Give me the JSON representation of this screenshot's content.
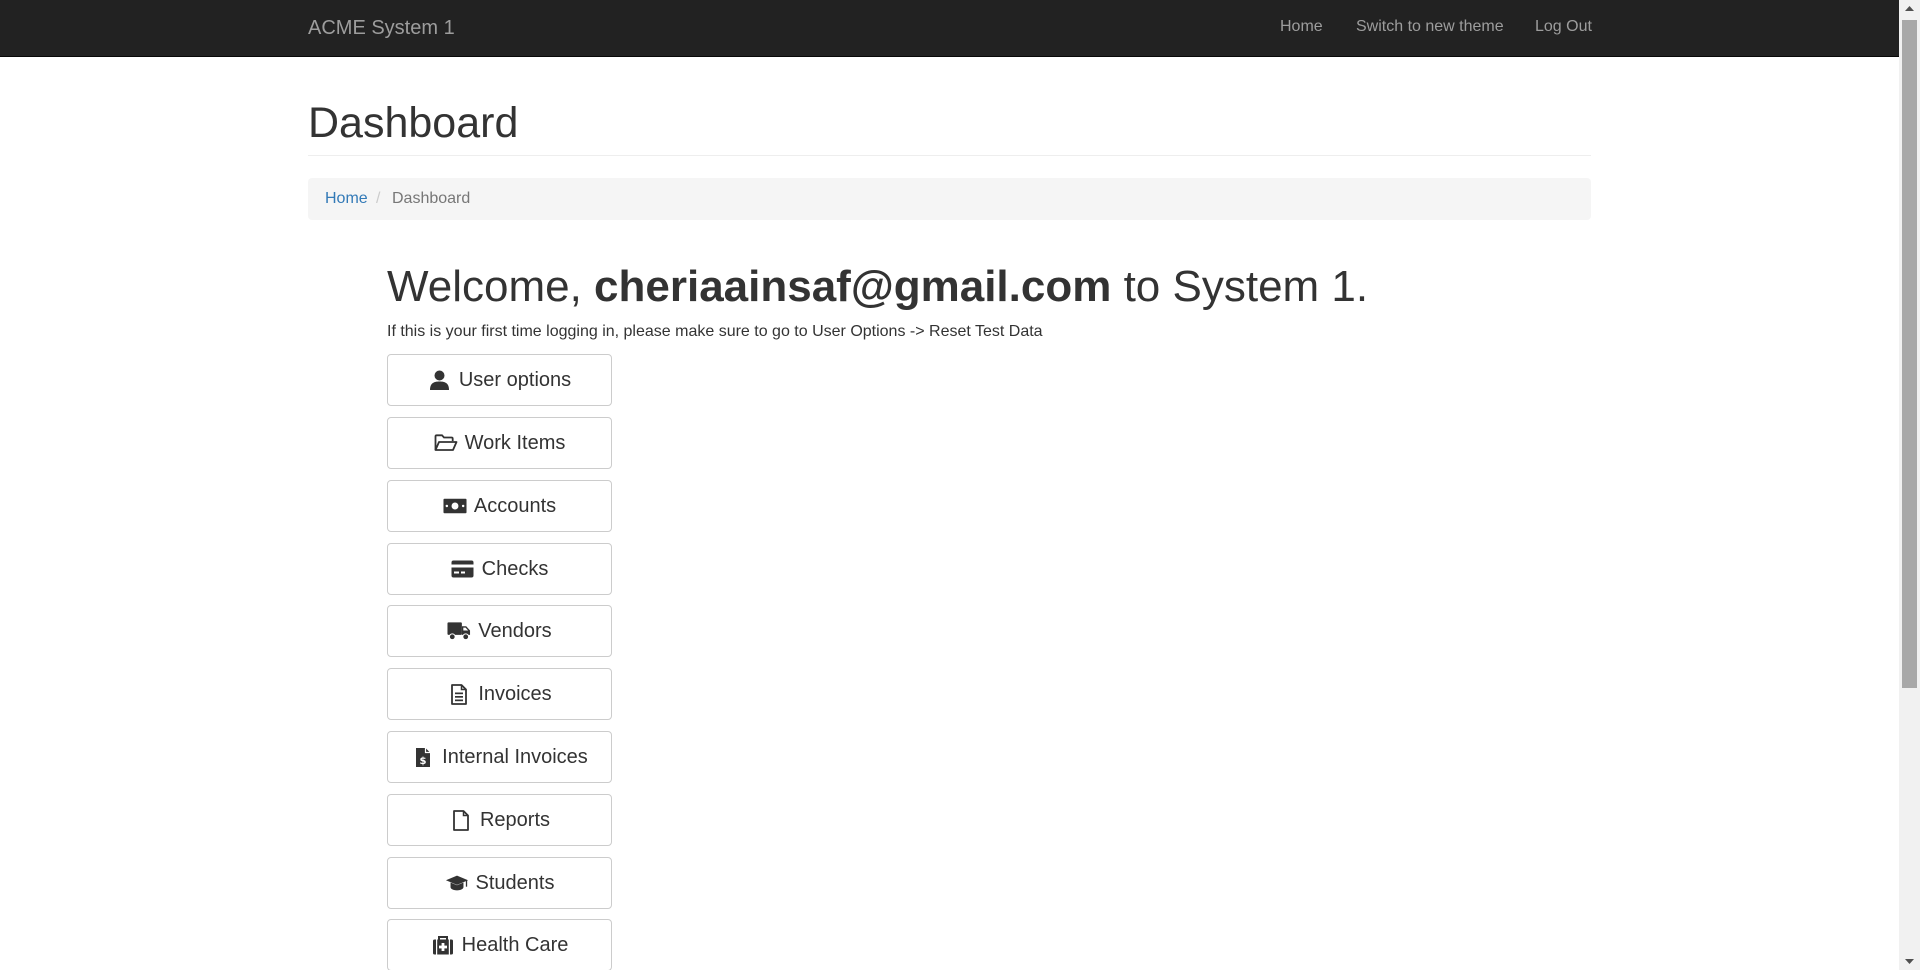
{
  "navbar": {
    "brand": "ACME System 1",
    "links": [
      {
        "label": "Home"
      },
      {
        "label": "Switch to new theme"
      },
      {
        "label": "Log Out"
      }
    ]
  },
  "page": {
    "title": "Dashboard"
  },
  "breadcrumb": {
    "home": "Home",
    "separator": "/",
    "current": "Dashboard"
  },
  "welcome": {
    "prefix": "Welcome, ",
    "email": "cheriaainsaf@gmail.com",
    "suffix": " to System 1.",
    "notice": "If this is your first time logging in, please make sure to go to User Options -> Reset Test Data"
  },
  "menu": [
    {
      "label": "User options",
      "icon": "user-icon"
    },
    {
      "label": "Work Items",
      "icon": "folder-open-icon"
    },
    {
      "label": "Accounts",
      "icon": "money-bill-icon"
    },
    {
      "label": "Checks",
      "icon": "credit-card-icon"
    },
    {
      "label": "Vendors",
      "icon": "truck-icon"
    },
    {
      "label": "Invoices",
      "icon": "file-text-icon"
    },
    {
      "label": "Internal Invoices",
      "icon": "file-invoice-dollar-icon"
    },
    {
      "label": "Reports",
      "icon": "file-icon"
    },
    {
      "label": "Students",
      "icon": "graduation-cap-icon"
    },
    {
      "label": "Health Care",
      "icon": "medkit-icon"
    }
  ],
  "colors": {
    "navbar_bg": "#222222",
    "navbar_text": "#9d9d9d",
    "link": "#337ab7",
    "breadcrumb_bg": "#f5f5f5"
  }
}
